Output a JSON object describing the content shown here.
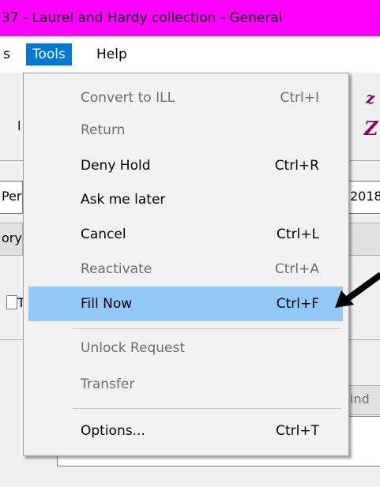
{
  "window": {
    "title": "37 - Laurel and Hardy collection - General"
  },
  "menubar": {
    "partial_label": "s",
    "tools_label": "Tools",
    "help_label": "Help"
  },
  "background": {
    "fragment_per": "Per",
    "fragment_2018": "2018",
    "fragment_ory": "ory",
    "fragment_t": "T",
    "fragment_ind": "ind",
    "fragment_l": "l",
    "logo_z1": "z",
    "logo_z2": "Z"
  },
  "tools_menu": {
    "items": [
      {
        "label": "Convert to ILL",
        "shortcut": "Ctrl+I",
        "enabled": false
      },
      {
        "label": "Return",
        "shortcut": "",
        "enabled": false
      },
      {
        "label": "Deny Hold",
        "shortcut": "Ctrl+R",
        "enabled": true
      },
      {
        "label": "Ask me later",
        "shortcut": "",
        "enabled": true
      },
      {
        "label": "Cancel",
        "shortcut": "Ctrl+L",
        "enabled": true
      },
      {
        "label": "Reactivate",
        "shortcut": "Ctrl+A",
        "enabled": false
      },
      {
        "label": "Fill Now",
        "shortcut": "Ctrl+F",
        "enabled": true,
        "highlighted": true
      },
      {
        "label": "Unlock Request",
        "shortcut": "",
        "enabled": false
      },
      {
        "label": "Transfer",
        "shortcut": "",
        "enabled": false
      },
      {
        "label": "Options...",
        "shortcut": "Ctrl+T",
        "enabled": true
      }
    ]
  },
  "colors": {
    "title_bar": "#ff00ff",
    "menu_selected": "#0078d7",
    "item_highlight": "#91c9f7",
    "disabled_text": "#6d6d6d",
    "arrow": "#000000"
  },
  "annotation": {
    "icon": "arrow-pointer-icon"
  }
}
